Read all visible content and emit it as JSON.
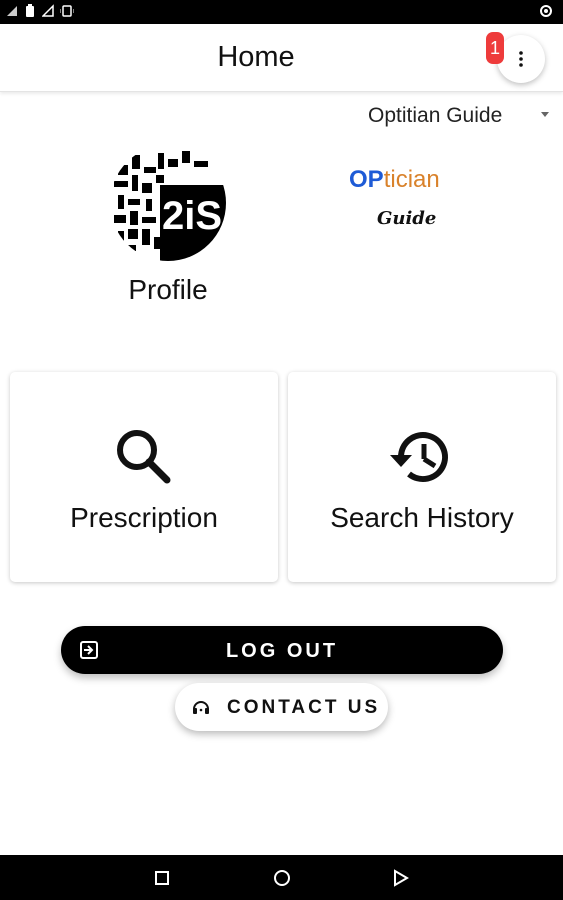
{
  "colors": {
    "status_bar": "#000000",
    "badge": "#ee3b3b",
    "logout_bg": "#000000",
    "logo_blue": "#1e5bd6",
    "logo_orange": "#d9822b"
  },
  "status_bar": {
    "icons": [
      "signal-icon",
      "battery-saver-icon",
      "no-signal-icon",
      "vibrate-icon",
      "notification-icon"
    ]
  },
  "app_bar": {
    "title": "Home",
    "badge_count": "1",
    "menu_icon": "more-vert-icon"
  },
  "dropdown": {
    "selected": "Optitian Guide"
  },
  "profile": {
    "label": "Profile",
    "avatar_text": "2iS"
  },
  "logo": {
    "op": "OP",
    "tician": "tician",
    "guide": "Guide"
  },
  "cards": {
    "prescription": {
      "label": "Prescription",
      "icon": "search-icon"
    },
    "history": {
      "label": "Search History",
      "icon": "history-icon"
    }
  },
  "buttons": {
    "logout": {
      "label": "LOG OUT",
      "icon": "logout-icon"
    },
    "contact": {
      "label": "CONTACT US",
      "icon": "headset-icon"
    }
  },
  "nav_bar": {
    "buttons": [
      "recent-apps-icon",
      "home-icon",
      "back-icon"
    ]
  }
}
